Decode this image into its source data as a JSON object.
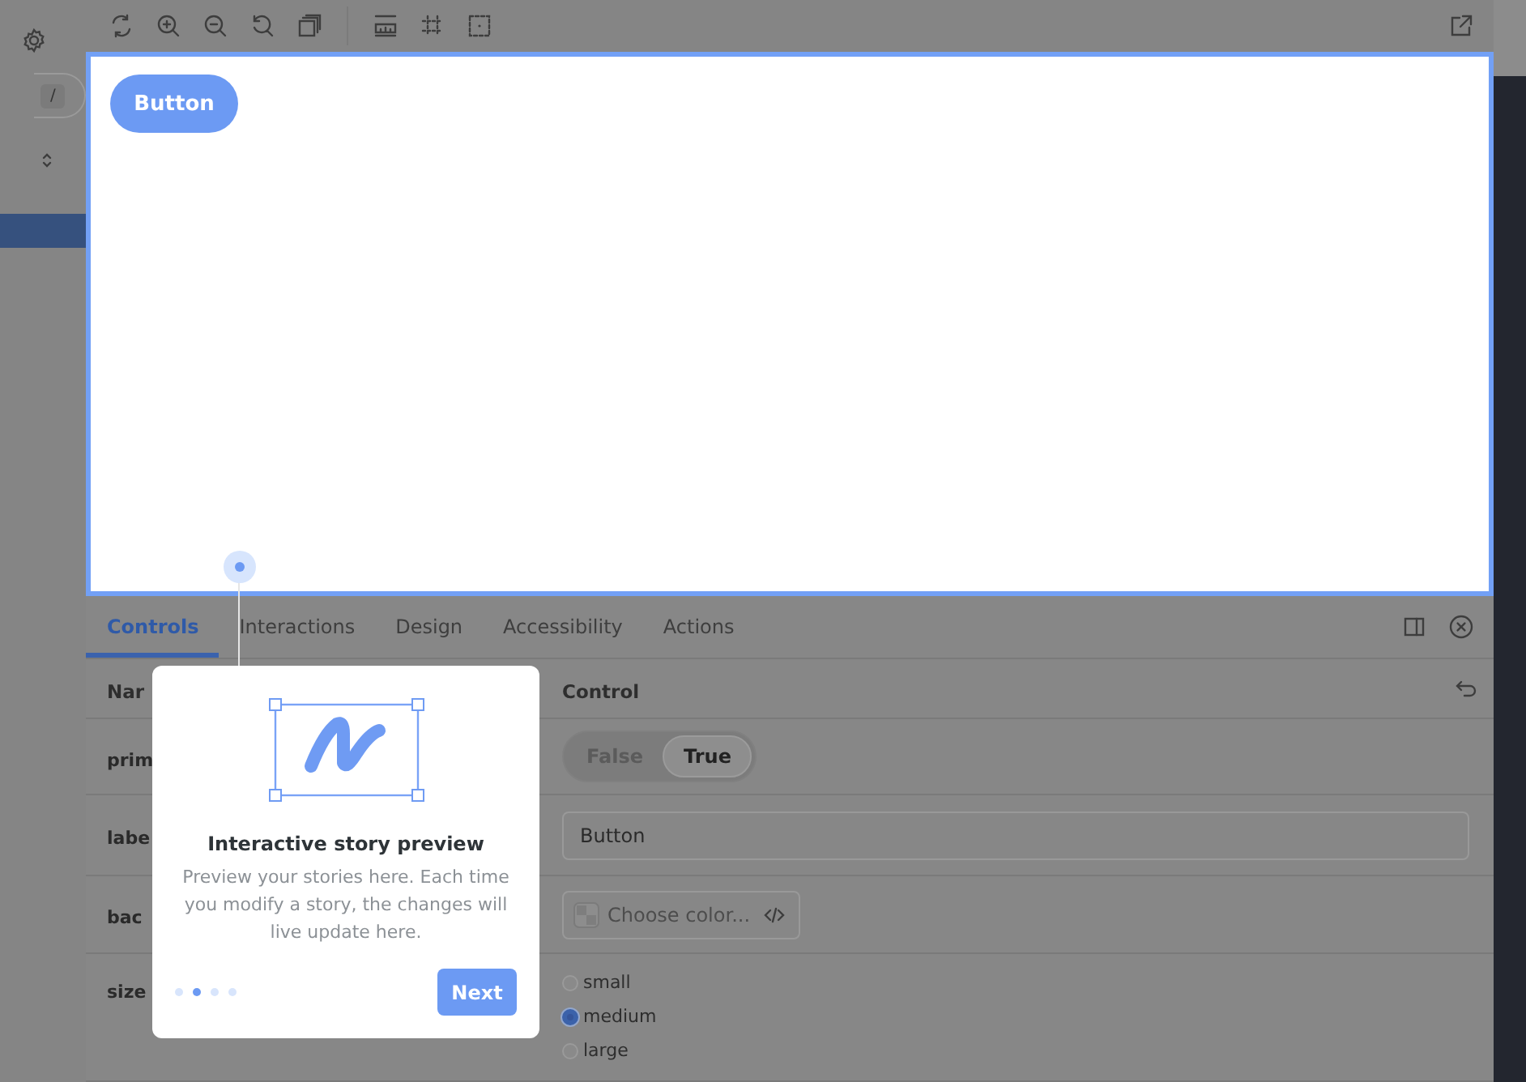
{
  "sidebar": {
    "search_shortcut": "/"
  },
  "preview": {
    "button_label": "Button"
  },
  "addon_panel": {
    "tabs": [
      {
        "label": "Controls",
        "selected": true
      },
      {
        "label": "Interactions",
        "selected": false
      },
      {
        "label": "Design",
        "selected": false
      },
      {
        "label": "Accessibility",
        "selected": false
      },
      {
        "label": "Actions",
        "selected": false
      }
    ]
  },
  "controls": {
    "columns": [
      "Nar",
      "Control"
    ],
    "rows": [
      {
        "kind": "boolean",
        "name": "prim",
        "options": [
          {
            "label": "False",
            "selected": false
          },
          {
            "label": "True",
            "selected": true
          }
        ]
      },
      {
        "kind": "text",
        "name": "labe",
        "value": "Button"
      },
      {
        "kind": "color",
        "name": "bac",
        "placeholder": "Choose color..."
      },
      {
        "kind": "radio",
        "name": "size",
        "options": [
          {
            "label": "small",
            "selected": false
          },
          {
            "label": "medium",
            "selected": true
          },
          {
            "label": "large",
            "selected": false
          }
        ]
      }
    ]
  },
  "tour": {
    "title": "Interactive story preview",
    "body": "Preview your stories here. Each time you modify a story, the changes will live update here.",
    "steps": [
      {
        "selected": false
      },
      {
        "selected": true
      },
      {
        "selected": false
      },
      {
        "selected": false
      }
    ],
    "next_button": "Next"
  }
}
